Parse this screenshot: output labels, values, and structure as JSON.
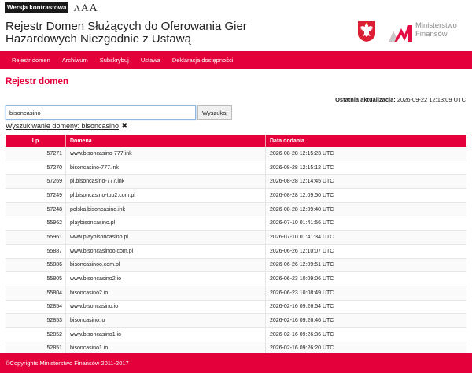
{
  "accessibility": {
    "contrast_label": "Wersja kontrastowa",
    "font_sizes": [
      "A",
      "A",
      "A"
    ]
  },
  "header": {
    "title_line1": "Rejestr Domen Służących do Oferowania Gier",
    "title_line2": "Hazardowych Niezgodnie z Ustawą",
    "ministry_line1": "Ministerstwo",
    "ministry_line2": "Finansów",
    "eagle_icon": "polish-eagle-emblem"
  },
  "nav": {
    "items": [
      "Rejestr domen",
      "Archiwum",
      "Subskrybuj",
      "Ustawa",
      "Deklaracja dostępności"
    ]
  },
  "main": {
    "heading": "Rejestr domen",
    "updated_label": "Ostatnia aktualizacja:",
    "updated_value": "2026-09-22 12:13:09 UTC",
    "search": {
      "value": "bisoncasino",
      "button": "Wyszukaj"
    },
    "query_label": "Wyszukiwanie domeny:",
    "query_value": "bisoncasino",
    "remove_icon": "close-x-icon"
  },
  "table": {
    "headers": [
      "Lp",
      "Domena",
      "Data dodania"
    ],
    "rows": [
      [
        "57271",
        "www.bisoncasino-777.ink",
        "2026-08-28 12:15:23 UTC"
      ],
      [
        "57270",
        "bisoncasino-777.ink",
        "2026-08-28 12:15:12 UTC"
      ],
      [
        "57269",
        "pl.bisoncasino-777.ink",
        "2026-08-28 12:14:45 UTC"
      ],
      [
        "57249",
        "pl.bisoncasino-top2.com.pl",
        "2026-08-28 12:09:50 UTC"
      ],
      [
        "57248",
        "polska.bisoncasino.ink",
        "2026-08-28 12:09:40 UTC"
      ],
      [
        "55962",
        "playbisoncasino.pl",
        "2026-07-10 01:41:56 UTC"
      ],
      [
        "55961",
        "www.playbisoncasino.pl",
        "2026-07-10 01:41:34 UTC"
      ],
      [
        "55887",
        "www.bisoncasinoo.com.pl",
        "2026-06-26 12:10:07 UTC"
      ],
      [
        "55886",
        "bisoncasinoo.com.pl",
        "2026-06-26 12:09:51 UTC"
      ],
      [
        "55805",
        "www.bisoncasino2.io",
        "2026-06-23 10:09:06 UTC"
      ],
      [
        "55804",
        "bisoncasino2.io",
        "2026-06-23 10:08:49 UTC"
      ],
      [
        "52854",
        "www.bisoncasino.io",
        "2026-02-16 09:26:54 UTC"
      ],
      [
        "52853",
        "bisoncasino.io",
        "2026-02-16 09:26:46 UTC"
      ],
      [
        "52852",
        "www.bisoncasino1.io",
        "2026-02-16 09:26:36 UTC"
      ],
      [
        "52851",
        "bisoncasino1.io",
        "2026-02-16 09:26:20 UTC"
      ]
    ]
  },
  "footer": {
    "copyright": "©Copyrights Ministerstwo Finansów 2011-2017"
  },
  "colors": {
    "brand_red": "#e4003a",
    "text": "#222222",
    "ministry_gray": "#8a8a8a"
  }
}
